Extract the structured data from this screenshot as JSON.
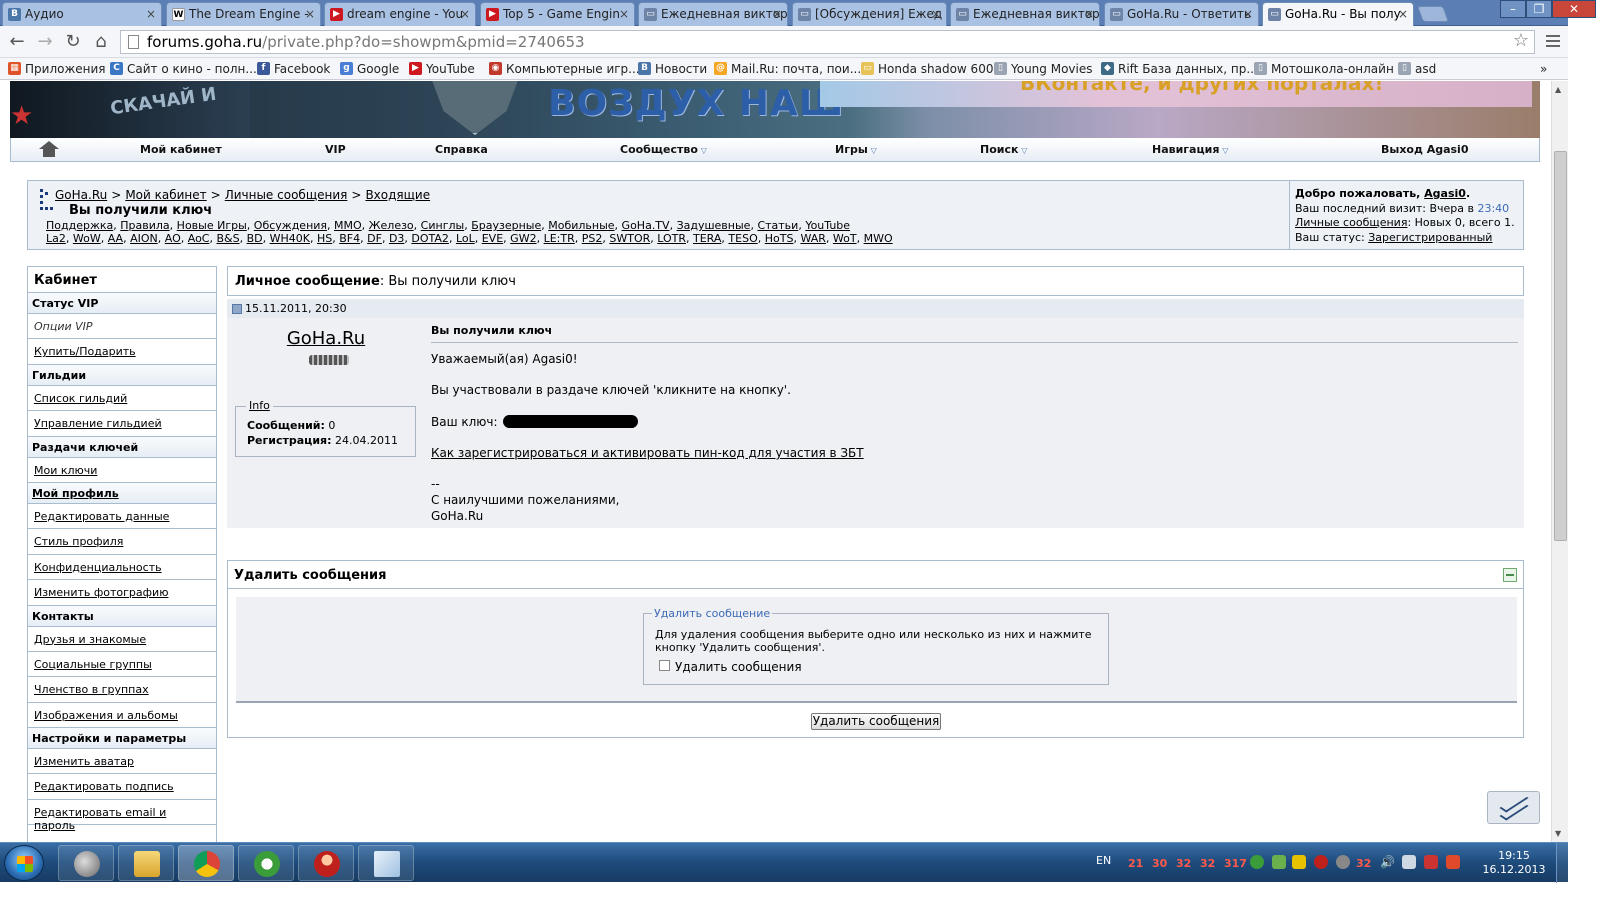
{
  "browser": {
    "tabs": [
      {
        "title": "Аудио",
        "icon": "vk-favicon",
        "color": "#4a76a8",
        "glyph": "B"
      },
      {
        "title": "The Dream Engine - ",
        "icon": "wikipedia-favicon",
        "color": "#ffffff",
        "glyph": "W"
      },
      {
        "title": "dream engine - You",
        "icon": "youtube-favicon",
        "color": "#cc181e",
        "glyph": "▶"
      },
      {
        "title": "Top 5 - Game Engin",
        "icon": "youtube-favicon",
        "color": "#cc181e",
        "glyph": "▶"
      },
      {
        "title": "Ежедневная виктор",
        "icon": "page-favicon",
        "color": "#6d84a8",
        "glyph": "▭"
      },
      {
        "title": "[Обсуждения] Ежед",
        "icon": "page-favicon",
        "color": "#6d84a8",
        "glyph": "▭"
      },
      {
        "title": "Ежедневная виктор",
        "icon": "page-favicon",
        "color": "#6d84a8",
        "glyph": "▭"
      },
      {
        "title": "GoHa.Ru - Ответить",
        "icon": "page-favicon",
        "color": "#6d84a8",
        "glyph": "▭"
      },
      {
        "title": "GoHa.Ru - Вы полу",
        "icon": "page-favicon",
        "color": "#6d84a8",
        "glyph": "▭",
        "active": true
      }
    ],
    "url_domain": "forums.goha.ru",
    "url_path": "/private.php?do=showpm&pmid=2740653",
    "bookmarks": [
      {
        "label": "Приложения",
        "icon": "apps-icon",
        "color": "#e0542b",
        "glyph": "▦"
      },
      {
        "label": "Сайт о кино - полн...",
        "icon": "kino-icon",
        "color": "#3b78c4",
        "glyph": "C"
      },
      {
        "label": "Facebook",
        "icon": "facebook-icon",
        "color": "#3b5998",
        "glyph": "f"
      },
      {
        "label": "Google",
        "icon": "google-icon",
        "color": "#4a7fd6",
        "glyph": "g"
      },
      {
        "label": "YouTube",
        "icon": "youtube-icon",
        "color": "#cc181e",
        "glyph": "▶"
      },
      {
        "label": "Компьютерные игр...",
        "icon": "games-icon",
        "color": "#c0392b",
        "glyph": "◉"
      },
      {
        "label": "Новости",
        "icon": "vk-icon",
        "color": "#4a76a8",
        "glyph": "B"
      },
      {
        "label": "Mail.Ru: почта, пои...",
        "icon": "mailru-icon",
        "color": "#f5a623",
        "glyph": "@"
      },
      {
        "label": "Honda shadow 600",
        "icon": "folder-icon",
        "color": "#e8c35a",
        "glyph": "▭"
      },
      {
        "label": "Young  Movies",
        "icon": "page-icon",
        "color": "#9aa4b2",
        "glyph": "▯"
      },
      {
        "label": "Rift База данных, пр...",
        "icon": "rift-icon",
        "color": "#3e6a86",
        "glyph": "◆"
      },
      {
        "label": "Мотошкола-онлайн",
        "icon": "page-icon",
        "color": "#9aa4b2",
        "glyph": "▯"
      },
      {
        "label": "asd",
        "icon": "page-icon",
        "color": "#9aa4b2",
        "glyph": "▯"
      }
    ],
    "bookmarks_more": "»"
  },
  "site": {
    "banner_text": "ВОЗДУХ НАШ",
    "banner_right_text": "ВКонтакте, и других порталах!",
    "banner_left_text": "СКАЧАЙ И"
  },
  "topnav": [
    {
      "label": "Мой кабинет",
      "dropdown": false
    },
    {
      "label": "VIP",
      "dropdown": false
    },
    {
      "label": "Справка",
      "dropdown": false
    },
    {
      "label": "Сообщество",
      "dropdown": true
    },
    {
      "label": "Игры",
      "dropdown": true
    },
    {
      "label": "Поиск",
      "dropdown": true
    },
    {
      "label": "Навигация",
      "dropdown": true
    },
    {
      "label": "Выход Agasi0",
      "dropdown": false
    }
  ],
  "breadcrumbs": [
    "GoHa.Ru",
    "Мой кабинет",
    "Личные сообщения",
    "Входящие"
  ],
  "breadcrumb_sep": ">",
  "page_title": "Вы получили ключ",
  "quicklinks_row1": [
    "Поддержка",
    "Правила",
    "Новые Игры",
    "Обсуждения",
    "ММО",
    "Железо",
    "Синглы",
    "Браузерные",
    "Мобильные",
    "GoHa.TV",
    "Задушевные",
    "Статьи",
    "YouTube"
  ],
  "quicklinks_row2": [
    "La2",
    "WoW",
    "AA",
    "AION",
    "AO",
    "AoC",
    "B&S",
    "BD",
    "WH40K",
    "HS",
    "BF4",
    "DF",
    "D3",
    "DOTA2",
    "LoL",
    "EVE",
    "GW2",
    "LE:TR",
    "PS2",
    "SWTOR",
    "LOTR",
    "TERA",
    "TESO",
    "HoTS",
    "WAR",
    "WoT",
    "MWO"
  ],
  "welcome": {
    "greeting": "Добро пожаловать, ",
    "username": "Agasi0",
    "last_visit_label": "Ваш последний визит: Вчера в ",
    "last_visit_time": "23:40",
    "pm_link": "Личные сообщения",
    "pm_counts": ": Новых 0, всего 1.",
    "status_label": "Ваш статус: ",
    "status_value": "Зарегистрированный"
  },
  "sidebar": {
    "title": "Кабинет",
    "entries": [
      {
        "type": "cat",
        "label": "Статус VIP"
      },
      {
        "type": "item",
        "label": "Опции VIP",
        "italic": true
      },
      {
        "type": "item",
        "label": "Купить/Подарить"
      },
      {
        "type": "cat",
        "label": "Гильдии"
      },
      {
        "type": "item",
        "label": "Список гильдий"
      },
      {
        "type": "item",
        "label": "Управление гильдией"
      },
      {
        "type": "cat",
        "label": "Раздачи ключей"
      },
      {
        "type": "item",
        "label": "Мои ключи"
      },
      {
        "type": "cat",
        "label": "Мой профиль",
        "underline": true
      },
      {
        "type": "item",
        "label": "Редактировать данные"
      },
      {
        "type": "item",
        "label": "Стиль профиля"
      },
      {
        "type": "item",
        "label": "Конфиденциальность"
      },
      {
        "type": "item",
        "label": "Изменить фотографию"
      },
      {
        "type": "cat",
        "label": "Контакты"
      },
      {
        "type": "item",
        "label": "Друзья и знакомые"
      },
      {
        "type": "item",
        "label": "Социальные группы"
      },
      {
        "type": "item",
        "label": "Членство в группах"
      },
      {
        "type": "item",
        "label": "Изображения и альбомы"
      },
      {
        "type": "cat",
        "label": "Настройки и параметры"
      },
      {
        "type": "item",
        "label": "Изменить аватар"
      },
      {
        "type": "item",
        "label": "Редактировать подпись"
      },
      {
        "type": "item",
        "label": "Редактировать email и пароль"
      }
    ]
  },
  "pm": {
    "header_label": "Личное сообщение",
    "header_title": ": Вы получили ключ",
    "date": "15.11.2011, 20:30",
    "author": "GoHa.Ru",
    "info_legend": "Info",
    "posts_label": "Сообщений:",
    "posts_value": "0",
    "reg_label": "Регистрация:",
    "reg_value": "24.04.2011",
    "subject": "Вы получили ключ",
    "greeting": "Уважаемый(ая) Agasi0!",
    "line1": "Вы участвовали в раздаче ключей 'кликните на кнопку'.",
    "key_label": "Ваш ключ:",
    "link_text": "Как зарегистрироваться и активировать пин-код для участия в ЗБТ",
    "sig_dash": "--",
    "sig_line1": "С наилучшими пожеланиями,",
    "sig_line2": "GoHa.Ru"
  },
  "delete_box": {
    "title": "Удалить сообщения",
    "legend": "Удалить сообщение",
    "text": "Для удаления сообщения выберите одно или несколько из них и нажмите кнопку 'Удалить сообщения'.",
    "checkbox_label": "Удалить сообщения",
    "button_label": "Удалить сообщения"
  },
  "taskbar": {
    "lang": "EN",
    "tray_numbers": [
      "21",
      "30",
      "32",
      "32",
      "317",
      "32"
    ],
    "time": "19:15",
    "date": "16.12.2013"
  },
  "colors": {
    "accent_blue": "#3d6ab5",
    "border": "#a9bbcf",
    "panel_bg": "#eef0f3"
  }
}
